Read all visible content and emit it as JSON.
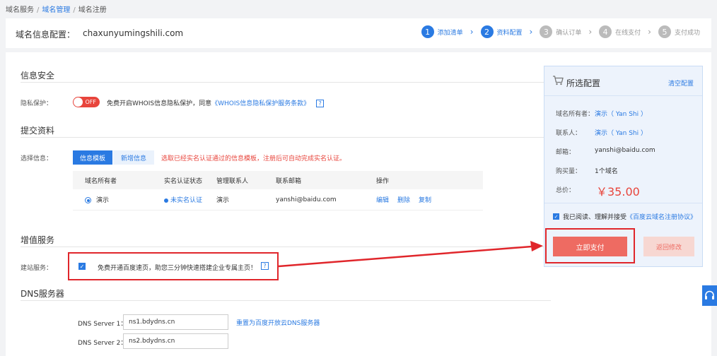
{
  "breadcrumb": {
    "item1": "域名服务",
    "item2": "域名管理",
    "item3": "域名注册",
    "sep": "/"
  },
  "header": {
    "title": "域名信息配置：",
    "domain": "chaxunyumingshili.com"
  },
  "steps": [
    {
      "num": "1",
      "label": "添加清单"
    },
    {
      "num": "2",
      "label": "资料配置"
    },
    {
      "num": "3",
      "label": "确认订单"
    },
    {
      "num": "4",
      "label": "在线支付"
    },
    {
      "num": "5",
      "label": "支付成功"
    }
  ],
  "info_security": {
    "title": "信息安全",
    "privacy_label": "隐私保护：",
    "toggle_text": "OFF",
    "privacy_text": "免费开启WHOIS信息隐私保护，同意",
    "privacy_link": "《WHOIS信息隐私保护服务条款》",
    "help": "?"
  },
  "submit": {
    "title": "提交资料",
    "select_label": "选择信息：",
    "tab_template": "信息模板",
    "tab_new": "新增信息",
    "hint": "选取已经实名认证通过的信息模板，注册后可自动完成实名认证。",
    "table": {
      "headers": [
        "域名所有者",
        "实名认证状态",
        "管理联系人",
        "联系邮箱",
        "操作"
      ],
      "row": {
        "owner": "演示",
        "status": "未实名认证",
        "contact": "演示",
        "email": "yanshi@baidu.com",
        "action_edit": "编辑",
        "action_delete": "删除",
        "action_copy": "复制"
      }
    }
  },
  "value_added": {
    "title": "增值服务",
    "site_label": "建站服务：",
    "check": "✓",
    "site_text": "免费开通百度速页，助您三分钟快速搭建企业专属主页！",
    "help": "?"
  },
  "dns": {
    "title": "DNS服务器",
    "server1_label": "DNS Server 1：",
    "server1_value": "ns1.bdydns.cn",
    "server2_label": "DNS Server 2：",
    "server2_value": "ns2.bdydns.cn",
    "reset_link": "重置为百度开放云DNS服务器"
  },
  "summary": {
    "title": "所选配置",
    "clear": "清空配置",
    "owner_label": "域名所有者：",
    "owner_value": "演示（ Yan Shi ）",
    "contact_label": "联系人：",
    "contact_value": "演示（ Yan Shi ）",
    "email_label": "邮箱：",
    "email_value": "yanshi@baidu.com",
    "qty_label": "购买量：",
    "qty_value": "1个域名",
    "total_label": "总价：",
    "price": "￥35.00",
    "check": "✓",
    "agree_text": "我已阅读、理解并接受",
    "agree_link": "《百度云域名注册协议》",
    "pay_button": "立即支付",
    "back_button": "返回修改"
  },
  "colors": {
    "accent": "#2a7ae2",
    "danger": "#e8453c",
    "annotation": "#e0262b"
  }
}
